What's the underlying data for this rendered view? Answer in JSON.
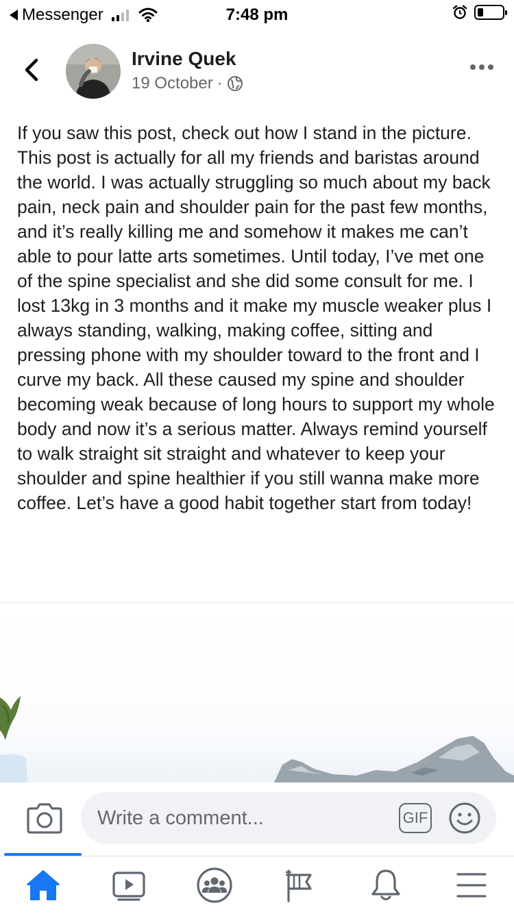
{
  "status_bar": {
    "back_app": "Messenger",
    "time": "7:48 pm",
    "signal_bars_active": 2,
    "signal_bars_total": 4,
    "battery_level": 0.22
  },
  "post": {
    "author": "Irvine Quek",
    "date": "19 October",
    "separator": "·",
    "privacy_icon": "globe-icon",
    "text": "If you saw this post, check out how I stand in the picture.\nThis post is actually for all my friends and baristas around the world. I was actually struggling so much about my back pain, neck pain and shoulder pain for the past few months, and it’s really killing me and somehow it makes me can’t able to pour latte arts sometimes. Until today, I’ve met one of the spine specialist and she did some consult for me. I lost 13kg in 3 months and it make my muscle weaker plus I always standing, walking, making coffee, sitting and pressing phone with my shoulder toward  to the front and I curve my back. All these caused my spine and shoulder becoming weak because of long hours to support my whole body and now it’s a serious matter. Always remind yourself to walk straight sit straight and whatever to keep your shoulder and spine healthier if you still wanna make more coffee. Let’s have a good habit together start from today!"
  },
  "comment_bar": {
    "placeholder": "Write a comment...",
    "gif_label": "GIF"
  },
  "bottom_nav": {
    "items": [
      "home-icon",
      "watch-icon",
      "groups-icon",
      "pages-icon",
      "notifications-icon",
      "menu-icon"
    ],
    "active_index": 0
  },
  "colors": {
    "accent": "#1877f2",
    "secondary_text": "#65676b",
    "icon_gray": "#606770",
    "input_bg": "#f0f2f5"
  }
}
